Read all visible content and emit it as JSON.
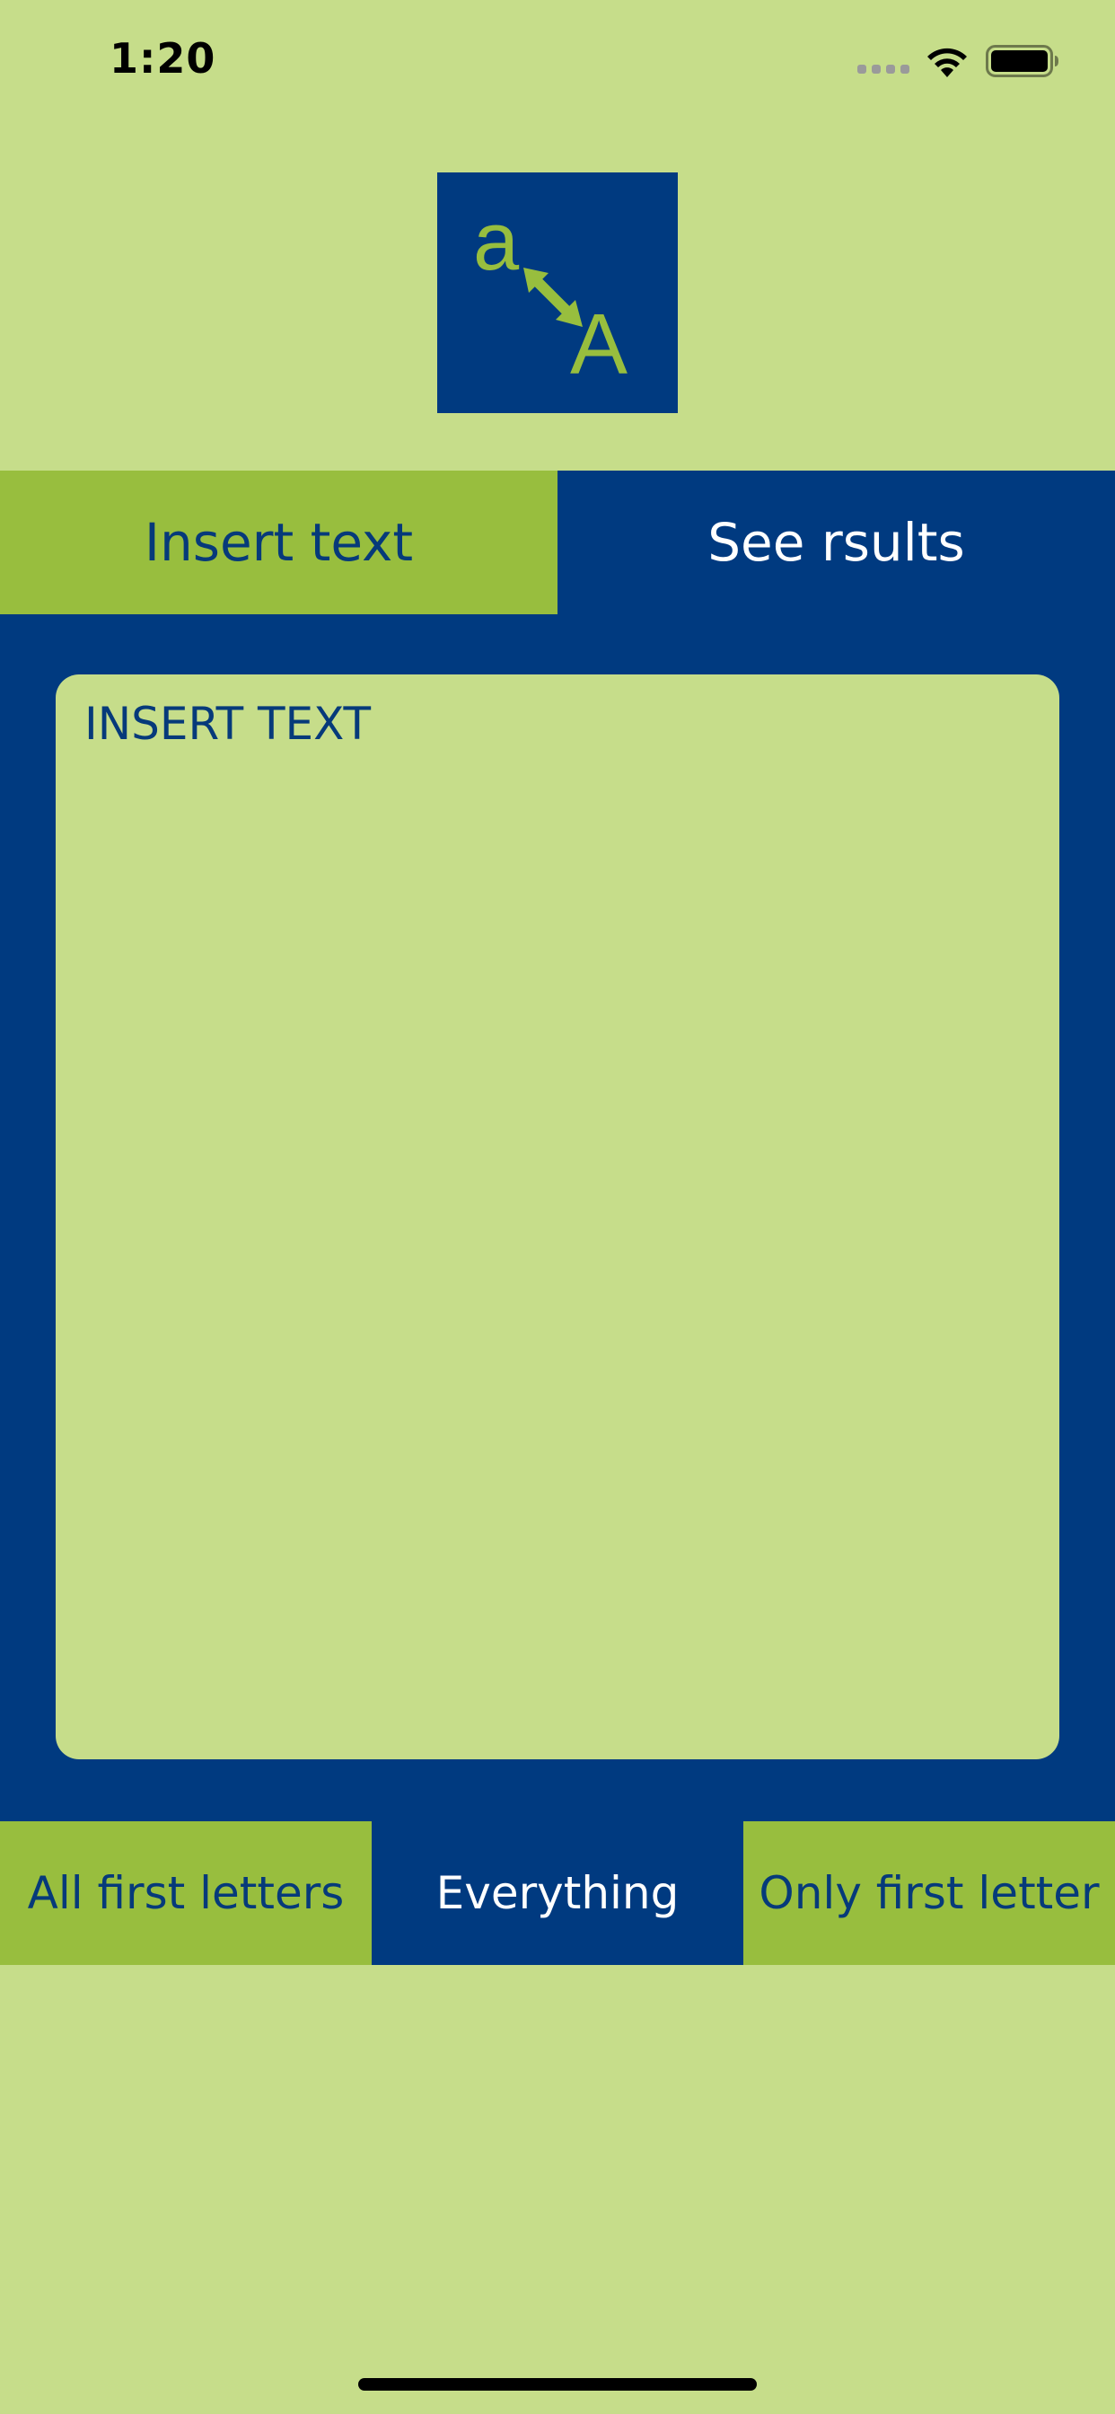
{
  "status_bar": {
    "time": "1:20",
    "icons": [
      "signal-icon",
      "wifi-icon",
      "battery-icon"
    ]
  },
  "logo": {
    "small_letter": "a",
    "capital_letter": "A",
    "icon": "resize-arrow-icon"
  },
  "top_tabs": {
    "insert_label": "Insert text",
    "results_label": "See rsults",
    "selected": "Insert text"
  },
  "text_area": {
    "value": "",
    "placeholder": "INSERT TEXT"
  },
  "options": {
    "items": [
      {
        "label": "All first letters"
      },
      {
        "label": "Everything"
      },
      {
        "label": "Only first letter"
      }
    ],
    "selected": "Everything"
  },
  "colors": {
    "background": "#c6dd8a",
    "navy": "#003a80",
    "green": "#98be3e",
    "text_navy": "#063a7a",
    "text_white": "#ffffff"
  }
}
